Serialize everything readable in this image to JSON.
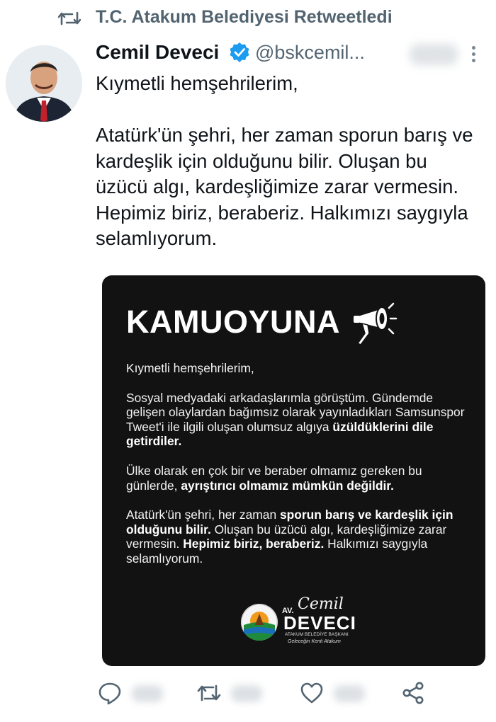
{
  "retweet_header": {
    "icon": "retweet-icon",
    "text": "T.C. Atakum Belediyesi Retweetledi"
  },
  "author": {
    "name": "Cemil Deveci",
    "verified_icon": "verified-badge-icon",
    "handle": "@bskcemil..."
  },
  "tweet": {
    "paragraphs": [
      "Kıymetli hemşehrilerim,",
      "Atatürk'ün şehri, her zaman sporun barış ve kardeşlik için olduğunu bilir. Oluşan bu üzücü algı, kardeşliğimize zarar vermesin. Hepimiz biriz, beraberiz. Halkımızı saygıyla selamlıyorum."
    ]
  },
  "media": {
    "title": "KAMUOYUNA",
    "icon": "megaphone-icon",
    "greeting": "Kıymetli hemşehrilerim,",
    "p1_text": "Sosyal medyadaki arkadaşlarımla görüştüm. Gündemde gelişen olaylardan bağımsız olarak yayınladıkları Samsunspor Tweet'i ile ilgili oluşan olumsuz algıya ",
    "p1_bold": "üzüldüklerini dile getirdiler.",
    "p2_text": "Ülke olarak en çok bir ve beraber olmamız gereken bu günlerde, ",
    "p2_bold": "ayrıştırıcı olmamız mümkün değildir.",
    "p3_a": "Atatürk'ün şehri, her zaman ",
    "p3_bold1": "sporun barış ve kardeşlik için olduğunu bilir.",
    "p3_b": " Oluşan bu üzücü algı, kardeşliğimize zarar vermesin. ",
    "p3_bold2": "Hepimiz biriz, beraberiz.",
    "p3_c": " Halkımızı saygıyla selamlıyorum.",
    "signature": {
      "prefix": "AV.",
      "script_name": "Cemil",
      "surname": "DEVECI",
      "subtitle": "ATAKUM BELEDİYE BAŞKANI",
      "tagline": "Geleceğin Kenti Atakum"
    }
  },
  "actions": {
    "reply_icon": "reply-icon",
    "retweet_icon": "retweet-icon",
    "like_icon": "heart-icon",
    "share_icon": "share-icon"
  },
  "colors": {
    "text": "#0f1419",
    "secondary": "#536471",
    "verified": "#1d9bf0",
    "card_bg": "#121212"
  }
}
